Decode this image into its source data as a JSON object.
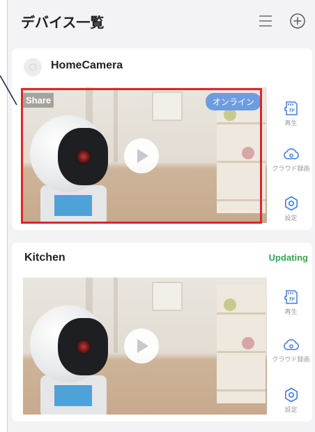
{
  "header": {
    "title": "デバイス一覧",
    "icons": [
      "menu-icon",
      "add-icon"
    ]
  },
  "devices": [
    {
      "name": "HomeCamera",
      "share_badge": "Share",
      "status_badge": "オンライン",
      "actions": [
        {
          "icon": "tf-card-icon",
          "label": "再生"
        },
        {
          "icon": "cloud-icon",
          "label": "クラウド録画"
        },
        {
          "icon": "settings-icon",
          "label": "設定"
        }
      ]
    },
    {
      "name": "Kitchen",
      "status": "Updating",
      "actions": [
        {
          "icon": "tf-card-icon",
          "label": "再生"
        },
        {
          "icon": "cloud-icon",
          "label": "クラウド録画"
        },
        {
          "icon": "settings-icon",
          "label": "設定"
        }
      ]
    }
  ],
  "colors": {
    "accent": "#3d7be0",
    "online_badge": "#6d9de0",
    "updating": "#33a652",
    "highlight": "#e0242b"
  }
}
